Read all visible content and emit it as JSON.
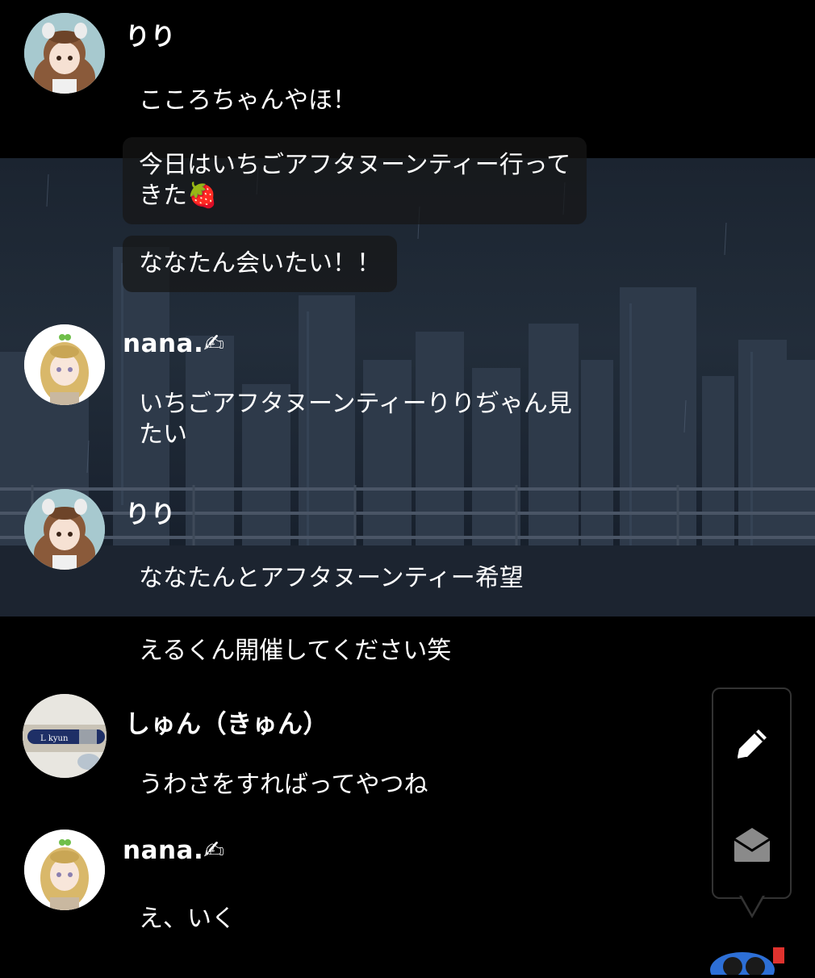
{
  "messages": [
    {
      "user": "りり",
      "avatar": "girl-brown-hair-avatar",
      "bubbles": [
        "こころちゃんやほ！",
        "今日はいちごアフタヌーンティー行って\nきた🍓",
        "ななたん会いたい！！"
      ]
    },
    {
      "user": "nana.✍",
      "avatar": "girl-blonde-hair-avatar",
      "bubbles": [
        "いちごアフタヌーンティーりりぢゃん見\nたい"
      ]
    },
    {
      "user": "りり",
      "avatar": "girl-brown-hair-avatar",
      "bubbles": [
        "ななたんとアフタヌーンティー希望",
        "えるくん開催してください笑"
      ]
    },
    {
      "user": "しゅん（きゅん）",
      "avatar": "pen-photo-avatar",
      "bubbles": [
        "うわさをすればってやつね"
      ]
    },
    {
      "user": "nana.✍",
      "avatar": "girl-blonde-hair-avatar",
      "bubbles": [
        "え、いく"
      ]
    }
  ],
  "actions": {
    "compose_icon": "pencil-icon",
    "inbox_icon": "open-envelope-icon"
  },
  "colors": {
    "background": "#000000",
    "bubble": "#161616",
    "scene": "#1f2935"
  }
}
